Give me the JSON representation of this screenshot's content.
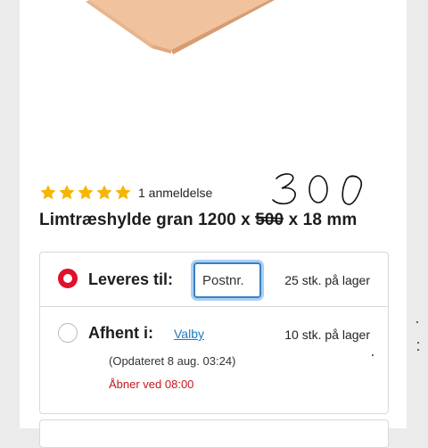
{
  "product": {
    "rating_stars": 5,
    "review_count": "1 anmeldelse",
    "title_before": "Limtræshylde gran 1200 x ",
    "title_struck": "500",
    "title_after": " x 18 mm",
    "handwritten_note": "300"
  },
  "delivery": {
    "deliver_label": "Leveres til:",
    "postnr_placeholder": "Postnr.",
    "deliver_stock": "25 stk. på lager",
    "pickup_label": "Afhent i:",
    "store_name": "Valby",
    "pickup_stock": "10 stk. på lager",
    "updated_text": "(Opdateret 8 aug. 03:24)",
    "opens_text": "Åbner ved 08:00"
  },
  "colors": {
    "star": "#f7b500",
    "accent_red": "#e0102b",
    "link_blue": "#1a7bc4",
    "focus_blue": "#3b7fc4",
    "wood": "#f2c6a0"
  }
}
